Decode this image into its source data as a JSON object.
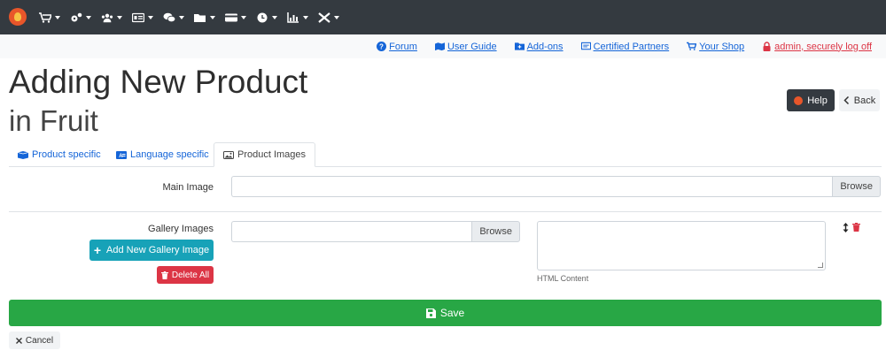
{
  "nav": {
    "items": [
      {
        "icon": "cart-icon"
      },
      {
        "icon": "gears-icon"
      },
      {
        "icon": "users-icon"
      },
      {
        "icon": "id-card-icon"
      },
      {
        "icon": "comments-icon"
      },
      {
        "icon": "folder-icon"
      },
      {
        "icon": "credit-card-icon"
      },
      {
        "icon": "clock-icon"
      },
      {
        "icon": "chart-icon"
      },
      {
        "icon": "tools-icon"
      }
    ]
  },
  "links": {
    "forum": "Forum",
    "user_guide": "User Guide",
    "addons": "Add-ons",
    "partners": "Certified Partners",
    "shop": "Your Shop",
    "logoff": "admin, securely log off"
  },
  "page": {
    "title": "Adding New Product",
    "subtitle": "in Fruit",
    "help": "Help",
    "back": "Back"
  },
  "tabs": {
    "product_specific": "Product specific",
    "language_specific": "Language specific",
    "product_images": "Product Images"
  },
  "form": {
    "main_image_label": "Main Image",
    "browse": "Browse",
    "gallery_label": "Gallery Images",
    "add_gallery": "Add New Gallery Image",
    "delete_all": "Delete All",
    "html_content": "HTML Content",
    "save": "Save",
    "cancel": "Cancel"
  },
  "colors": {
    "navbar": "#343a40",
    "link": "#1565d8",
    "save": "#28a745",
    "add": "#17a2b8",
    "danger": "#dc3545"
  }
}
